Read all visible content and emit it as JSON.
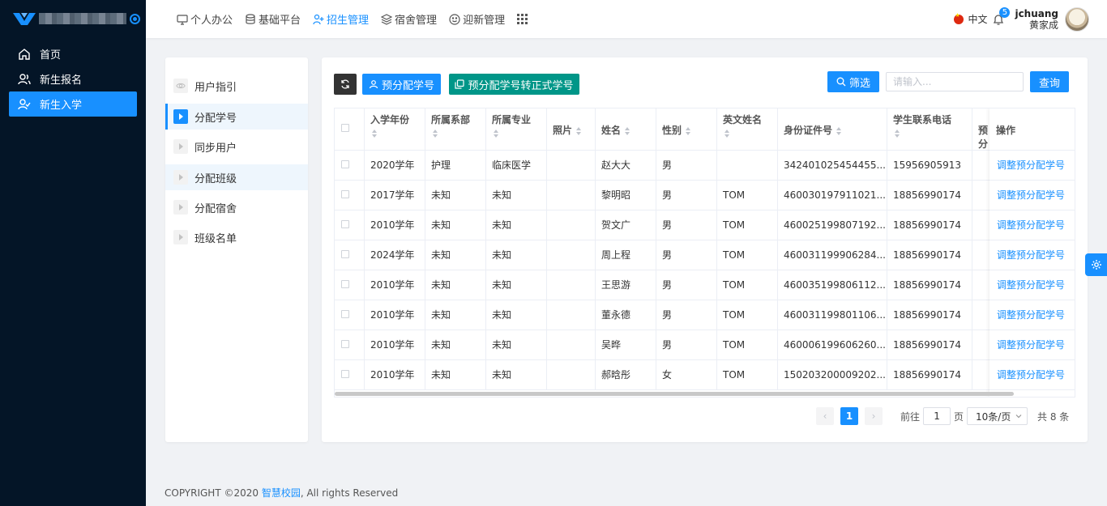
{
  "sidebar": {
    "items": [
      {
        "label": "首页",
        "icon": "home-icon"
      },
      {
        "label": "新生报名",
        "icon": "users-icon"
      },
      {
        "label": "新生入学",
        "icon": "user-check-icon",
        "active": true
      }
    ]
  },
  "topnav": {
    "items": [
      {
        "label": "个人办公",
        "icon": "monitor-icon"
      },
      {
        "label": "基础平台",
        "icon": "database-icon"
      },
      {
        "label": "招生管理",
        "icon": "user-plus-icon",
        "active": true
      },
      {
        "label": "宿舍管理",
        "icon": "layers-icon"
      },
      {
        "label": "迎新管理",
        "icon": "smile-icon"
      }
    ],
    "lang": "中文",
    "notifications": "5",
    "user_id": "jchuang",
    "user_name": "黄家成"
  },
  "left_panel": {
    "items": [
      {
        "label": "用户指引",
        "icon": "eye-icon"
      },
      {
        "label": "分配学号",
        "current": true
      },
      {
        "label": "同步用户"
      },
      {
        "label": "分配班级"
      },
      {
        "label": "分配宿舍"
      },
      {
        "label": "班级名单"
      }
    ]
  },
  "toolbar": {
    "prealloc_label": "预分配学号",
    "convert_label": "预分配学号转正式学号",
    "filter_label": "筛选",
    "search_placeholder": "请输入...",
    "query_label": "查询"
  },
  "table": {
    "columns": [
      "入学年份",
      "所属系部",
      "所属专业",
      "照片",
      "姓名",
      "性别",
      "英文姓名",
      "身份证件号",
      "学生联系电话",
      "预分",
      "操作"
    ],
    "rows": [
      {
        "year": "2020学年",
        "dept": "护理",
        "major": "临床医学",
        "name": "赵大大",
        "gender": "男",
        "en": "",
        "id": "342401025454455...",
        "phone": "15956905913",
        "op": "调整预分配学号"
      },
      {
        "year": "2017学年",
        "dept": "未知",
        "major": "未知",
        "name": "黎明昭",
        "gender": "男",
        "en": "TOM",
        "id": "460030197911021...",
        "phone": "18856990174",
        "op": "调整预分配学号"
      },
      {
        "year": "2010学年",
        "dept": "未知",
        "major": "未知",
        "name": "贺文广",
        "gender": "男",
        "en": "TOM",
        "id": "460025199807192...",
        "phone": "18856990174",
        "op": "调整预分配学号"
      },
      {
        "year": "2024学年",
        "dept": "未知",
        "major": "未知",
        "name": "周上程",
        "gender": "男",
        "en": "TOM",
        "id": "460031199906284...",
        "phone": "18856990174",
        "op": "调整预分配学号"
      },
      {
        "year": "2010学年",
        "dept": "未知",
        "major": "未知",
        "name": "王思游",
        "gender": "男",
        "en": "TOM",
        "id": "460035199806112...",
        "phone": "18856990174",
        "op": "调整预分配学号"
      },
      {
        "year": "2010学年",
        "dept": "未知",
        "major": "未知",
        "name": "董永德",
        "gender": "男",
        "en": "TOM",
        "id": "460031199801106...",
        "phone": "18856990174",
        "op": "调整预分配学号"
      },
      {
        "year": "2010学年",
        "dept": "未知",
        "major": "未知",
        "name": "吴晔",
        "gender": "男",
        "en": "TOM",
        "id": "460006199606260...",
        "phone": "18856990174",
        "op": "调整预分配学号"
      },
      {
        "year": "2010学年",
        "dept": "未知",
        "major": "未知",
        "name": "郝晗彤",
        "gender": "女",
        "en": "TOM",
        "id": "150203200009202...",
        "phone": "18856990174",
        "op": "调整预分配学号"
      }
    ]
  },
  "pager": {
    "current": "1",
    "goto_prefix": "前往",
    "goto_value": "1",
    "goto_suffix": "页",
    "page_size": "10条/页",
    "total": "共 8 条"
  },
  "footer": {
    "prefix": "COPYRIGHT ©2020 ",
    "link": "智慧校园",
    "suffix": ", All rights Reserved"
  },
  "colors": {
    "primary": "#1890ff",
    "sidebar": "#041527",
    "green": "#009688"
  }
}
